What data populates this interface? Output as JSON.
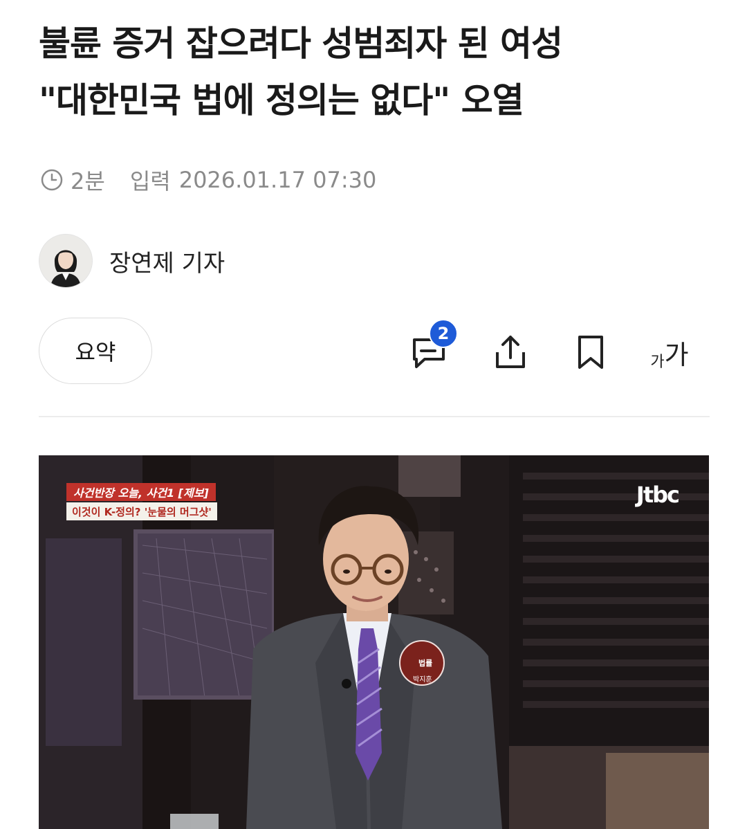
{
  "article": {
    "title_line1": "불륜 증거 잡으려다 성범죄자 된 여성",
    "title_line2": "\"대한민국 법에 정의는 없다\" 오열",
    "read_time": "2분",
    "input_label": "입력",
    "input_datetime": "2026.01.17 07:30",
    "author": "장연제 기자"
  },
  "toolbar": {
    "summary_label": "요약",
    "comment_count": "2",
    "font_small": "가",
    "font_large": "가"
  },
  "photo": {
    "caption_line1": "사건반장 오늘, 사건1 [제보]",
    "caption_line2": "이것이 K-정의? '눈물의 머그샷'",
    "broadcaster_logo": "Jtbc",
    "name_pin_title": "법률",
    "name_pin_name": "박지훈"
  },
  "icons": [
    "clock-icon",
    "comment-icon",
    "share-icon",
    "bookmark-icon",
    "font-size-icon"
  ],
  "colors": {
    "badge": "#1e5bd8",
    "caption_red": "#c0322b"
  }
}
